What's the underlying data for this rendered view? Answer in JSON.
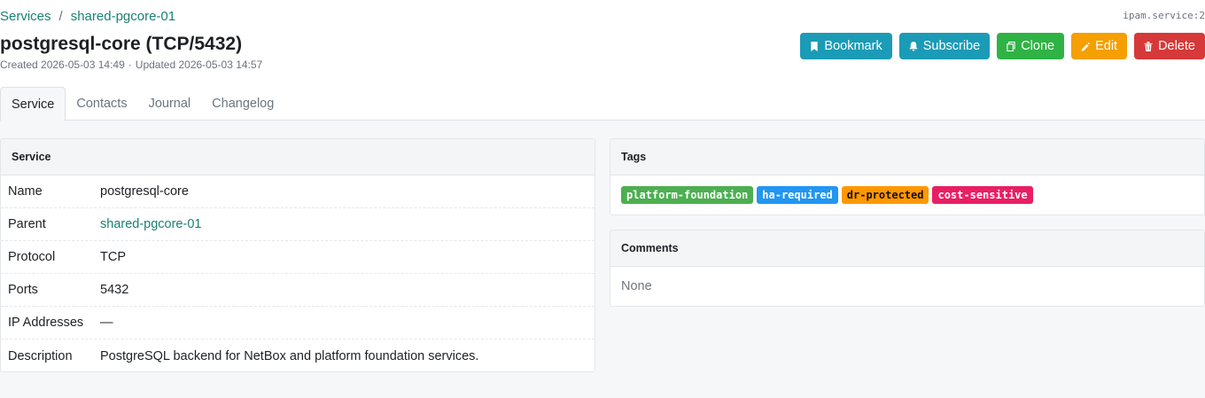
{
  "breadcrumb": {
    "parent_list": "Services",
    "separator": "/",
    "current": "shared-pgcore-01"
  },
  "object_id": "ipam.service:2",
  "title": "postgresql-core (TCP/5432)",
  "meta": {
    "created": "Created 2026-05-03 14:49",
    "dot": "·",
    "updated": "Updated 2026-05-03 14:57"
  },
  "actions": [
    {
      "label": "Bookmark",
      "icon": "bookmark-icon",
      "color": "#1b9bb6"
    },
    {
      "label": "Subscribe",
      "icon": "bell-icon",
      "color": "#1b9bb6"
    },
    {
      "label": "Clone",
      "icon": "copy-icon",
      "color": "#2fb344"
    },
    {
      "label": "Edit",
      "icon": "pencil-icon",
      "color": "#f59f00"
    },
    {
      "label": "Delete",
      "icon": "trash-icon",
      "color": "#d63939"
    }
  ],
  "tabs": [
    {
      "label": "Service",
      "active": true
    },
    {
      "label": "Contacts"
    },
    {
      "label": "Journal"
    },
    {
      "label": "Changelog"
    }
  ],
  "service_card": {
    "header": "Service",
    "rows": [
      {
        "label": "Name",
        "value": "postgresql-core"
      },
      {
        "label": "Parent",
        "value": "shared-pgcore-01"
      },
      {
        "label": "Protocol",
        "value": "TCP"
      },
      {
        "label": "Ports",
        "value": "5432"
      },
      {
        "label": "IP Addresses",
        "value": "—"
      },
      {
        "label": "Description",
        "value": "PostgreSQL backend for NetBox and platform foundation services."
      }
    ]
  },
  "tags_card": {
    "header": "Tags",
    "tags": [
      {
        "label": "platform-foundation",
        "color": "#4caf50"
      },
      {
        "label": "ha-required",
        "color": "#2196f3"
      },
      {
        "label": "dr-protected",
        "color": "#ff9800"
      },
      {
        "label": "cost-sensitive",
        "color": "#e91e63"
      }
    ]
  },
  "comments_card": {
    "header": "Comments",
    "body": "None"
  }
}
